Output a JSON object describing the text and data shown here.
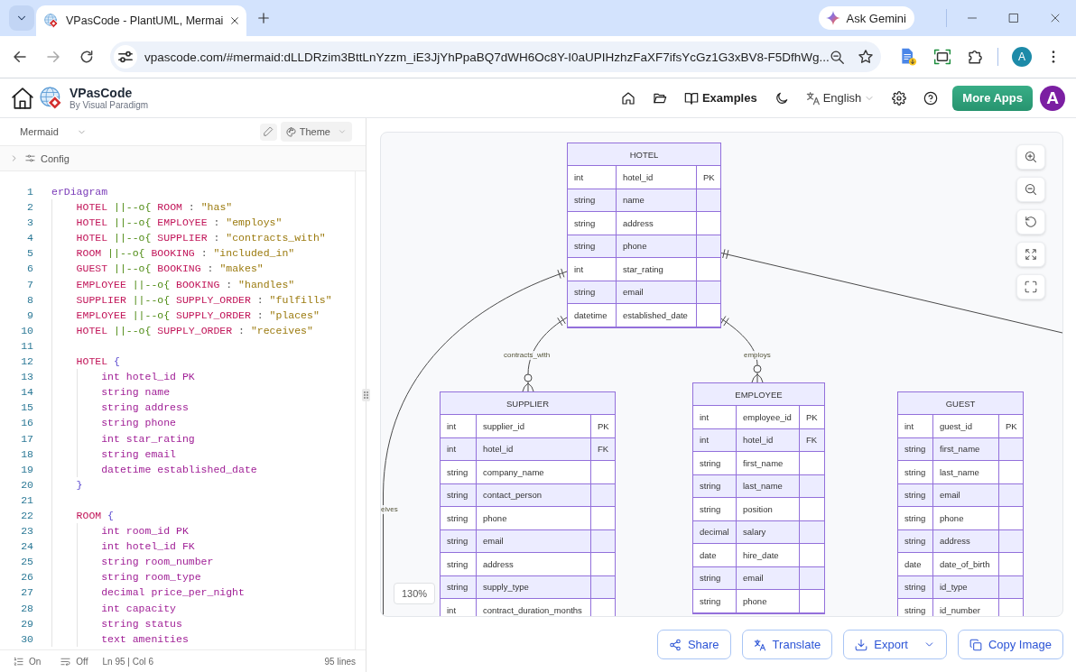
{
  "browser": {
    "tabs": [
      {
        "title": "VPasCode - PlantUML, Mermai",
        "selected": true
      }
    ],
    "ask_button": "Ask Gemini",
    "forward_disabled": true,
    "address": "vpascode.com/#mermaid:dLLDRzim3BttLnYzzm_iE3JjYhPpaBQ7dWH6Oc8Y-I0aUPIHzhzFaXF7ifsYcGz1G3xBV8-F5DfhWg...",
    "profile_initial": "A"
  },
  "header": {
    "brand": "VPasCode",
    "byline": "By Visual Paradigm",
    "examples_link": "Examples",
    "language": "English",
    "more_apps_button": "More Apps",
    "avatar_initial": "A"
  },
  "editor": {
    "language": "Mermaid",
    "theme_button": "Theme",
    "config": {
      "label": "Config",
      "expanded": false
    },
    "lines": [
      {
        "number": "1",
        "tokens": [
          {
            "kind": "keyword",
            "text": "erDiagram"
          }
        ],
        "children": [
          {
            "number": "2",
            "tokens": [
              {
                "kind": "entity",
                "text": "HOTEL"
              },
              {
                "kind": "relation",
                "text": "||--o{"
              },
              {
                "kind": "entity",
                "text": "ROOM"
              },
              {
                "kind": "punct",
                "text": ":"
              },
              {
                "kind": "string",
                "text": "\"has\""
              }
            ]
          },
          {
            "number": "3",
            "tokens": [
              {
                "kind": "entity",
                "text": "HOTEL"
              },
              {
                "kind": "relation",
                "text": "||--o{"
              },
              {
                "kind": "entity",
                "text": "EMPLOYEE"
              },
              {
                "kind": "punct",
                "text": ":"
              },
              {
                "kind": "string",
                "text": "\"employs\""
              }
            ]
          },
          {
            "number": "4",
            "tokens": [
              {
                "kind": "entity",
                "text": "HOTEL"
              },
              {
                "kind": "relation",
                "text": "||--o{"
              },
              {
                "kind": "entity",
                "text": "SUPPLIER"
              },
              {
                "kind": "punct",
                "text": ":"
              },
              {
                "kind": "string",
                "text": "\"contracts_with\""
              }
            ]
          },
          {
            "number": "5",
            "tokens": [
              {
                "kind": "entity",
                "text": "ROOM"
              },
              {
                "kind": "relation",
                "text": "||--o{"
              },
              {
                "kind": "entity",
                "text": "BOOKING"
              },
              {
                "kind": "punct",
                "text": ":"
              },
              {
                "kind": "string",
                "text": "\"included_in\""
              }
            ]
          },
          {
            "number": "6",
            "tokens": [
              {
                "kind": "entity",
                "text": "GUEST"
              },
              {
                "kind": "relation",
                "text": "||--o{"
              },
              {
                "kind": "entity",
                "text": "BOOKING"
              },
              {
                "kind": "punct",
                "text": ":"
              },
              {
                "kind": "string",
                "text": "\"makes\""
              }
            ]
          },
          {
            "number": "7",
            "tokens": [
              {
                "kind": "entity",
                "text": "EMPLOYEE"
              },
              {
                "kind": "relation",
                "text": "||--o{"
              },
              {
                "kind": "entity",
                "text": "BOOKING"
              },
              {
                "kind": "punct",
                "text": ":"
              },
              {
                "kind": "string",
                "text": "\"handles\""
              }
            ]
          },
          {
            "number": "8",
            "tokens": [
              {
                "kind": "entity",
                "text": "SUPPLIER"
              },
              {
                "kind": "relation",
                "text": "||--o{"
              },
              {
                "kind": "entity",
                "text": "SUPPLY_ORDER"
              },
              {
                "kind": "punct",
                "text": ":"
              },
              {
                "kind": "string",
                "text": "\"fulfills\""
              }
            ]
          },
          {
            "number": "9",
            "tokens": [
              {
                "kind": "entity",
                "text": "EMPLOYEE"
              },
              {
                "kind": "relation",
                "text": "||--o{"
              },
              {
                "kind": "entity",
                "text": "SUPPLY_ORDER"
              },
              {
                "kind": "punct",
                "text": ":"
              },
              {
                "kind": "string",
                "text": "\"places\""
              }
            ]
          },
          {
            "number": "10",
            "tokens": [
              {
                "kind": "entity",
                "text": "HOTEL"
              },
              {
                "kind": "relation",
                "text": "||--o{"
              },
              {
                "kind": "entity",
                "text": "SUPPLY_ORDER"
              },
              {
                "kind": "punct",
                "text": ":"
              },
              {
                "kind": "string",
                "text": "\"receives\""
              }
            ]
          },
          {
            "number": "11"
          },
          {
            "number": "12",
            "tokens": [
              {
                "kind": "entity",
                "text": "HOTEL"
              },
              {
                "kind": "brace",
                "text": "{"
              }
            ],
            "children": [
              {
                "number": "13",
                "tokens": [
                  {
                    "kind": "attribute",
                    "text": "int hotel_id PK"
                  }
                ]
              },
              {
                "number": "14",
                "tokens": [
                  {
                    "kind": "attribute",
                    "text": "string name"
                  }
                ]
              },
              {
                "number": "15",
                "tokens": [
                  {
                    "kind": "attribute",
                    "text": "string address"
                  }
                ]
              },
              {
                "number": "16",
                "tokens": [
                  {
                    "kind": "attribute",
                    "text": "string phone"
                  }
                ]
              },
              {
                "number": "17",
                "tokens": [
                  {
                    "kind": "attribute",
                    "text": "int star_rating"
                  }
                ]
              },
              {
                "number": "18",
                "tokens": [
                  {
                    "kind": "attribute",
                    "text": "string email"
                  }
                ]
              },
              {
                "number": "19",
                "tokens": [
                  {
                    "kind": "attribute",
                    "text": "datetime established_date"
                  }
                ]
              }
            ]
          },
          {
            "number": "20",
            "tokens": [
              {
                "kind": "brace",
                "text": "}"
              }
            ]
          },
          {
            "number": "21"
          },
          {
            "number": "22",
            "tokens": [
              {
                "kind": "entity",
                "text": "ROOM"
              },
              {
                "kind": "brace",
                "text": "{"
              }
            ],
            "children": [
              {
                "number": "23",
                "tokens": [
                  {
                    "kind": "attribute",
                    "text": "int room_id PK"
                  }
                ]
              },
              {
                "number": "24",
                "tokens": [
                  {
                    "kind": "attribute",
                    "text": "int hotel_id FK"
                  }
                ]
              },
              {
                "number": "25",
                "tokens": [
                  {
                    "kind": "attribute",
                    "text": "string room_number"
                  }
                ]
              },
              {
                "number": "26",
                "tokens": [
                  {
                    "kind": "attribute",
                    "text": "string room_type"
                  }
                ]
              },
              {
                "number": "27",
                "tokens": [
                  {
                    "kind": "attribute",
                    "text": "decimal price_per_night"
                  }
                ]
              },
              {
                "number": "28",
                "tokens": [
                  {
                    "kind": "attribute",
                    "text": "int capacity"
                  }
                ]
              },
              {
                "number": "29",
                "tokens": [
                  {
                    "kind": "attribute",
                    "text": "string status"
                  }
                ]
              },
              {
                "number": "30",
                "tokens": [
                  {
                    "kind": "attribute",
                    "text": "text amenities"
                  }
                ]
              }
            ]
          }
        ]
      }
    ],
    "status_bar": {
      "line_numbers": "On",
      "word_wrap": "Off",
      "cursor": "Ln 95 | Col 6",
      "line_count": "95 lines"
    }
  },
  "diagram": {
    "entities": [
      {
        "name": "HOTEL",
        "attributes": [
          {
            "type": "int",
            "name": "hotel_id",
            "key": "PK"
          },
          {
            "type": "string",
            "name": "name"
          },
          {
            "type": "string",
            "name": "address"
          },
          {
            "type": "string",
            "name": "phone"
          },
          {
            "type": "int",
            "name": "star_rating"
          },
          {
            "type": "string",
            "name": "email"
          },
          {
            "type": "datetime",
            "name": "established_date"
          }
        ]
      },
      {
        "name": "SUPPLIER",
        "attributes": [
          {
            "type": "int",
            "name": "supplier_id",
            "key": "PK"
          },
          {
            "type": "int",
            "name": "hotel_id",
            "key": "FK"
          },
          {
            "type": "string",
            "name": "company_name"
          },
          {
            "type": "string",
            "name": "contact_person"
          },
          {
            "type": "string",
            "name": "phone"
          },
          {
            "type": "string",
            "name": "email"
          },
          {
            "type": "string",
            "name": "address"
          },
          {
            "type": "string",
            "name": "supply_type"
          },
          {
            "type": "int",
            "name": "contract_duration_months"
          }
        ]
      },
      {
        "name": "EMPLOYEE",
        "attributes": [
          {
            "type": "int",
            "name": "employee_id",
            "key": "PK"
          },
          {
            "type": "int",
            "name": "hotel_id",
            "key": "FK"
          },
          {
            "type": "string",
            "name": "first_name"
          },
          {
            "type": "string",
            "name": "last_name"
          },
          {
            "type": "string",
            "name": "position"
          },
          {
            "type": "decimal",
            "name": "salary"
          },
          {
            "type": "date",
            "name": "hire_date"
          },
          {
            "type": "string",
            "name": "email"
          },
          {
            "type": "string",
            "name": "phone"
          }
        ]
      },
      {
        "name": "GUEST",
        "attributes": [
          {
            "type": "int",
            "name": "guest_id",
            "key": "PK"
          },
          {
            "type": "string",
            "name": "first_name"
          },
          {
            "type": "string",
            "name": "last_name"
          },
          {
            "type": "string",
            "name": "email"
          },
          {
            "type": "string",
            "name": "phone"
          },
          {
            "type": "string",
            "name": "address"
          },
          {
            "type": "date",
            "name": "date_of_birth"
          },
          {
            "type": "string",
            "name": "id_type"
          },
          {
            "type": "string",
            "name": "id_number"
          }
        ]
      }
    ],
    "relationships": [
      {
        "label": "contracts_with",
        "ends": [
          {
            "kind": "one"
          },
          {
            "kind": "many"
          }
        ]
      },
      {
        "label": "employs",
        "ends": [
          {
            "kind": "one"
          },
          {
            "kind": "many"
          }
        ]
      },
      {
        "label": "eives",
        "ends": [
          {
            "kind": "one"
          }
        ]
      },
      {
        "ends": [
          {
            "kind": "one"
          }
        ]
      }
    ],
    "zoom_level": "130%"
  },
  "actions": [
    {
      "kind": "share",
      "label": "Share",
      "dropdown": false
    },
    {
      "kind": "translate",
      "label": "Translate",
      "dropdown": false
    },
    {
      "kind": "export",
      "label": "Export",
      "dropdown": true
    },
    {
      "kind": "copy-image",
      "label": "Copy Image",
      "dropdown": false
    }
  ]
}
